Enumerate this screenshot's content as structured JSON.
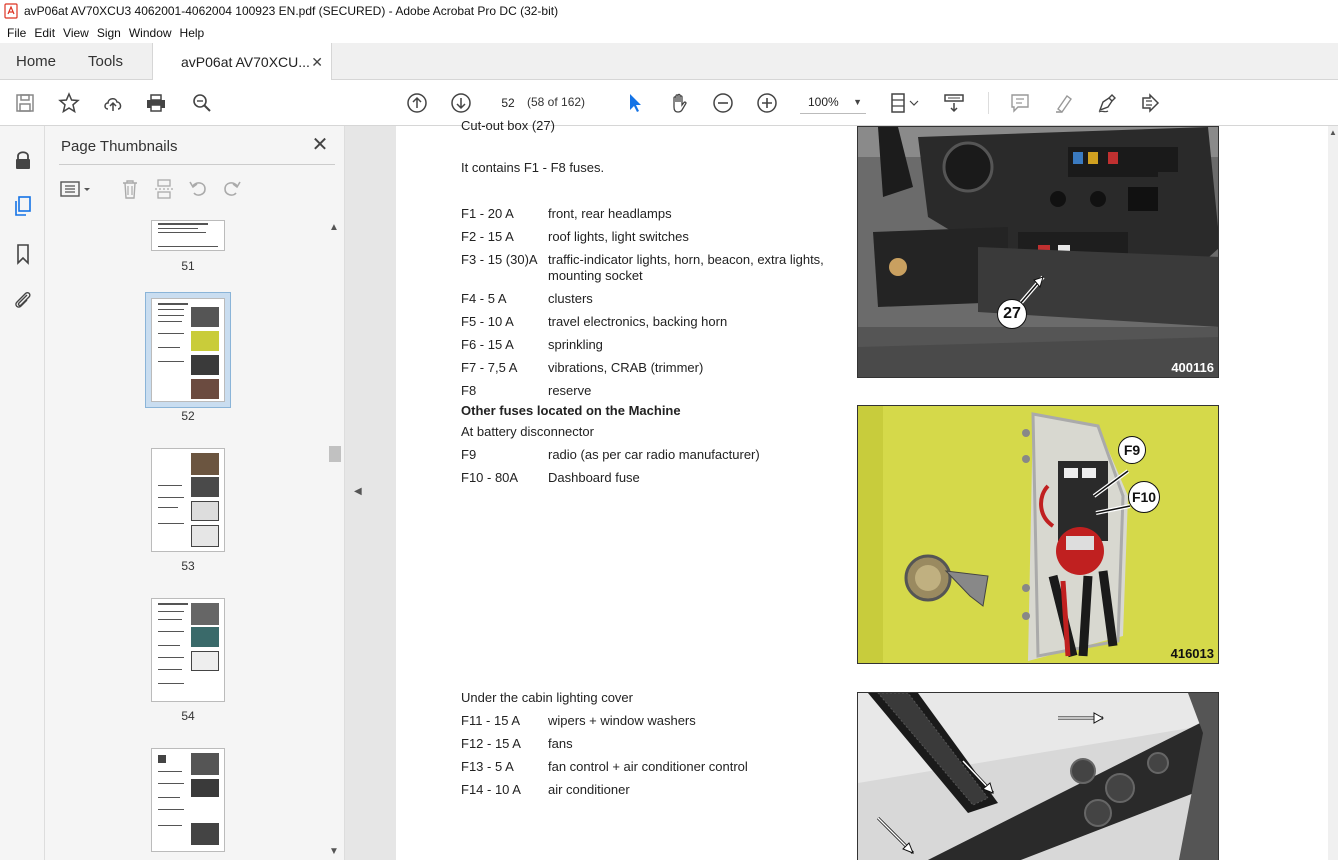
{
  "window": {
    "title": "avP06at AV70XCU3 4062001-4062004 100923 EN.pdf (SECURED) - Adobe Acrobat Pro DC (32-bit)"
  },
  "menu": [
    "File",
    "Edit",
    "View",
    "Sign",
    "Window",
    "Help"
  ],
  "tabs": {
    "home": "Home",
    "tools": "Tools",
    "document": "avP06at AV70XCU..."
  },
  "toolbar": {
    "page_number": "52",
    "page_count": "(58 of 162)",
    "zoom": "100%"
  },
  "sidebar": {
    "title": "Page Thumbnails",
    "thumbnails": [
      {
        "label": "51"
      },
      {
        "label": "52"
      },
      {
        "label": "53"
      },
      {
        "label": "54"
      }
    ]
  },
  "doc": {
    "heading_cut": "Cut-out box (27)",
    "intro": "It contains F1 - F8 fuses.",
    "fuses_a": [
      {
        "code": "F1 - 20 A",
        "desc": "front, rear headlamps"
      },
      {
        "code": "F2 - 15 A",
        "desc": "roof lights, light switches"
      },
      {
        "code": "F3 - 15 (30)A",
        "desc": "traffic-indicator lights, horn, beacon, extra lights,",
        "desc2": "mounting socket"
      },
      {
        "code": "F4 - 5 A",
        "desc": "clusters"
      },
      {
        "code": "F5 - 10 A",
        "desc": "travel electronics, backing horn"
      },
      {
        "code": "F6 - 15 A",
        "desc": "sprinkling"
      },
      {
        "code": "F7 - 7,5 A",
        "desc": "vibrations, CRAB (trimmer)"
      },
      {
        "code": "F8",
        "desc": "reserve"
      }
    ],
    "other_heading": "Other fuses located on the Machine",
    "battery_heading": "At battery disconnector",
    "fuses_b": [
      {
        "code": "F9",
        "desc": "radio (as per car radio manufacturer)"
      },
      {
        "code": "F10 - 80A",
        "desc": "Dashboard fuse"
      }
    ],
    "cabin_heading": "Under the cabin lighting cover",
    "fuses_c": [
      {
        "code": "F11 - 15 A",
        "desc": "wipers + window washers"
      },
      {
        "code": "F12 - 15 A",
        "desc": "fans"
      },
      {
        "code": "F13 - 5 A",
        "desc": "fan control + air conditioner control"
      },
      {
        "code": "F14 - 10 A",
        "desc": "air conditioner"
      }
    ],
    "photos": {
      "photo1_label": "400116",
      "photo1_callout": "27",
      "photo2_label": "416013",
      "photo2_callout_f9": "F9",
      "photo2_callout_f10": "F10"
    }
  },
  "colors": {
    "accent": "#1473e6",
    "yellow_panel": "#d8dc4a"
  }
}
